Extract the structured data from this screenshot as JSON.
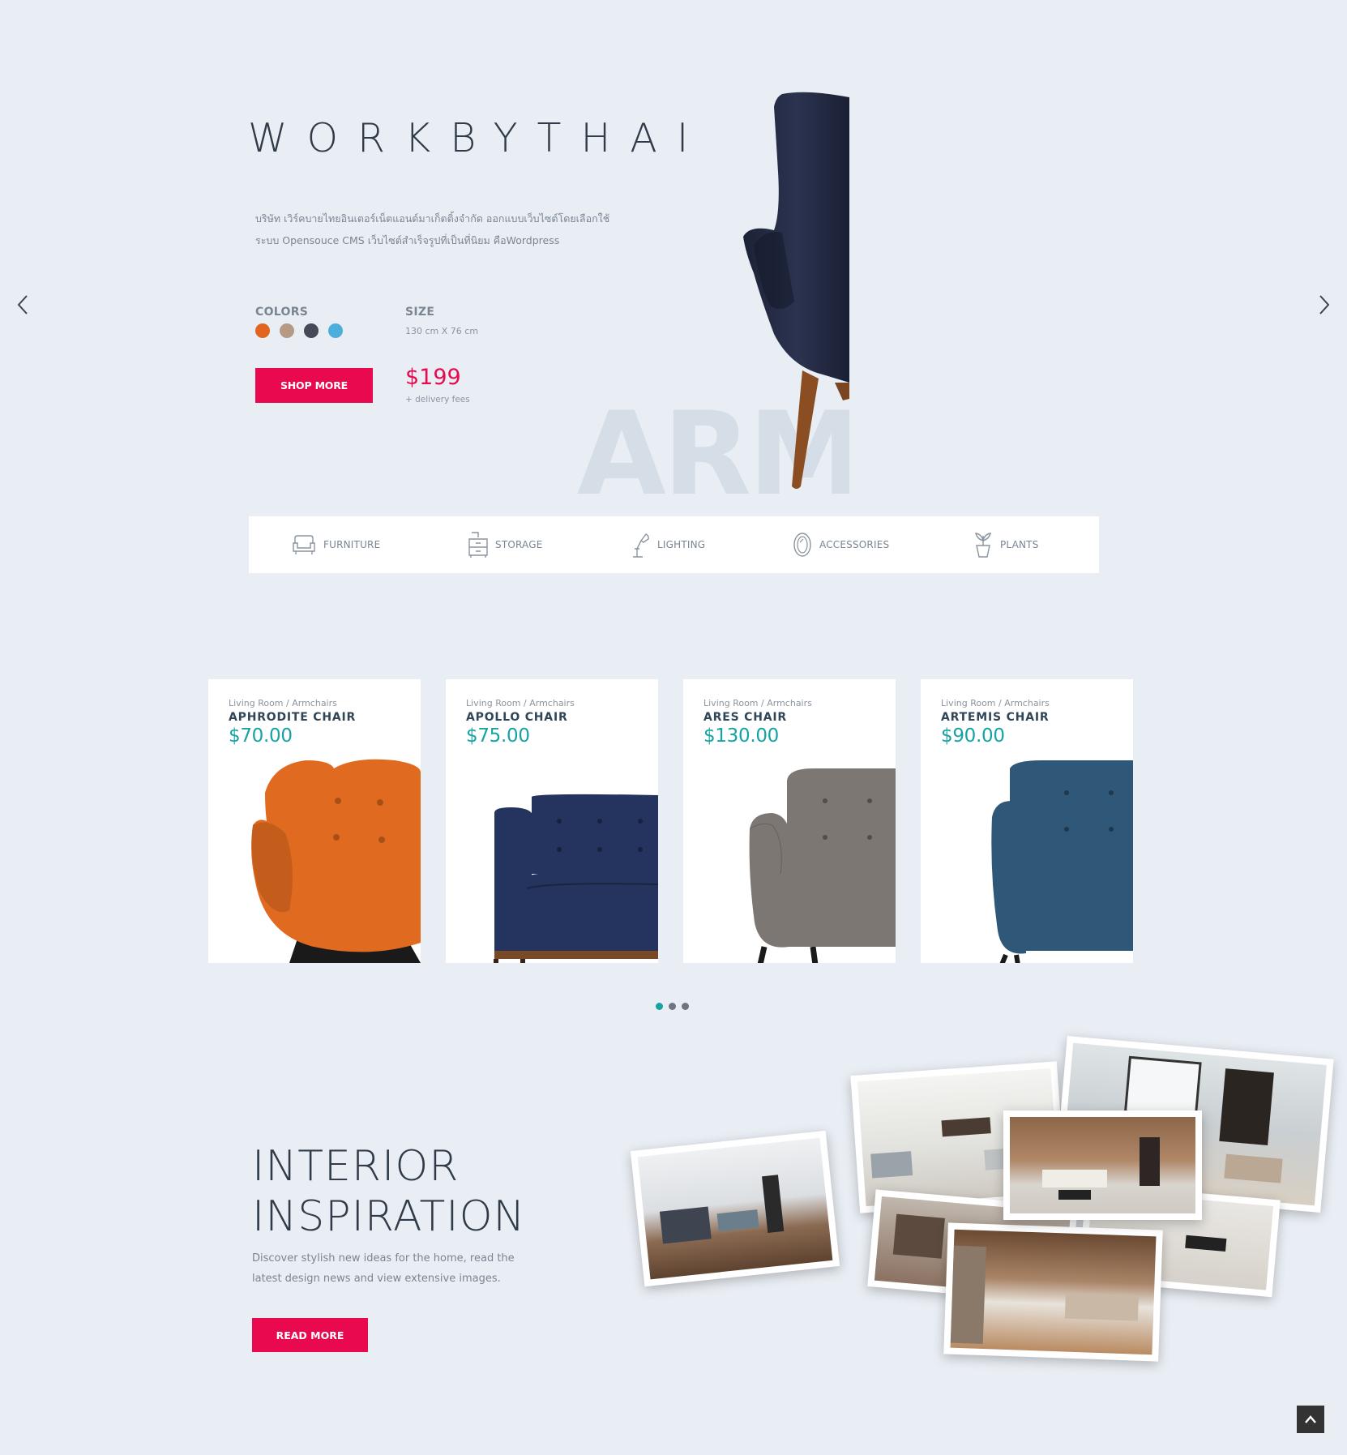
{
  "hero": {
    "title": "WORKBYTHAI",
    "description": "บริษัท เวิร์คบายไทยอินเตอร์เน็ตแอนด์มาเก็ตติ้งจำกัด ออกแบบเว็บไซต์โดยเลือกใช้ระบบ Opensouce CMS เว็บไซต์สำเร็จรูปที่เป็นที่นิยม คือWordpress",
    "colors_label": "COLORS",
    "size_label": "SIZE",
    "size_value": "130 cm X 76 cm",
    "swatches": [
      "#e2651f",
      "#b79a86",
      "#464a58",
      "#4eaedb"
    ],
    "shop_button": "SHOP MORE",
    "price": "$199",
    "price_note": "+ delivery fees",
    "watermark": "ARMC"
  },
  "categories": [
    {
      "label": "FURNITURE",
      "icon": "sofa-icon"
    },
    {
      "label": "STORAGE",
      "icon": "cabinet-icon"
    },
    {
      "label": "LIGHTING",
      "icon": "desk-lamp-icon"
    },
    {
      "label": "ACCESSORIES",
      "icon": "mirror-icon"
    },
    {
      "label": "PLANTS",
      "icon": "plant-pot-icon"
    }
  ],
  "products": [
    {
      "category": "Living Room / Armchairs",
      "name": "APHRODITE CHAIR",
      "price": "$70.00",
      "color": "#e06a1f"
    },
    {
      "category": "Living Room / Armchairs",
      "name": "APOLLO CHAIR",
      "price": "$75.00",
      "color": "#24345e"
    },
    {
      "category": "Living Room / Armchairs",
      "name": "ARES CHAIR",
      "price": "$130.00",
      "color": "#7d7774"
    },
    {
      "category": "Living Room / Armchairs",
      "name": "ARTEMIS CHAIR",
      "price": "$90.00",
      "color": "#2e5778"
    }
  ],
  "carousel": {
    "pages": 3,
    "active": 1
  },
  "inspiration": {
    "title_line1": "INTERIOR",
    "title_line2": "INSPIRATION",
    "description": "Discover stylish new ideas for the home, read the latest design news and view extensive images.",
    "button": "READ MORE"
  },
  "colors": {
    "accent": "#e8094f",
    "teal": "#16a3a3",
    "background": "#e9eef4"
  }
}
